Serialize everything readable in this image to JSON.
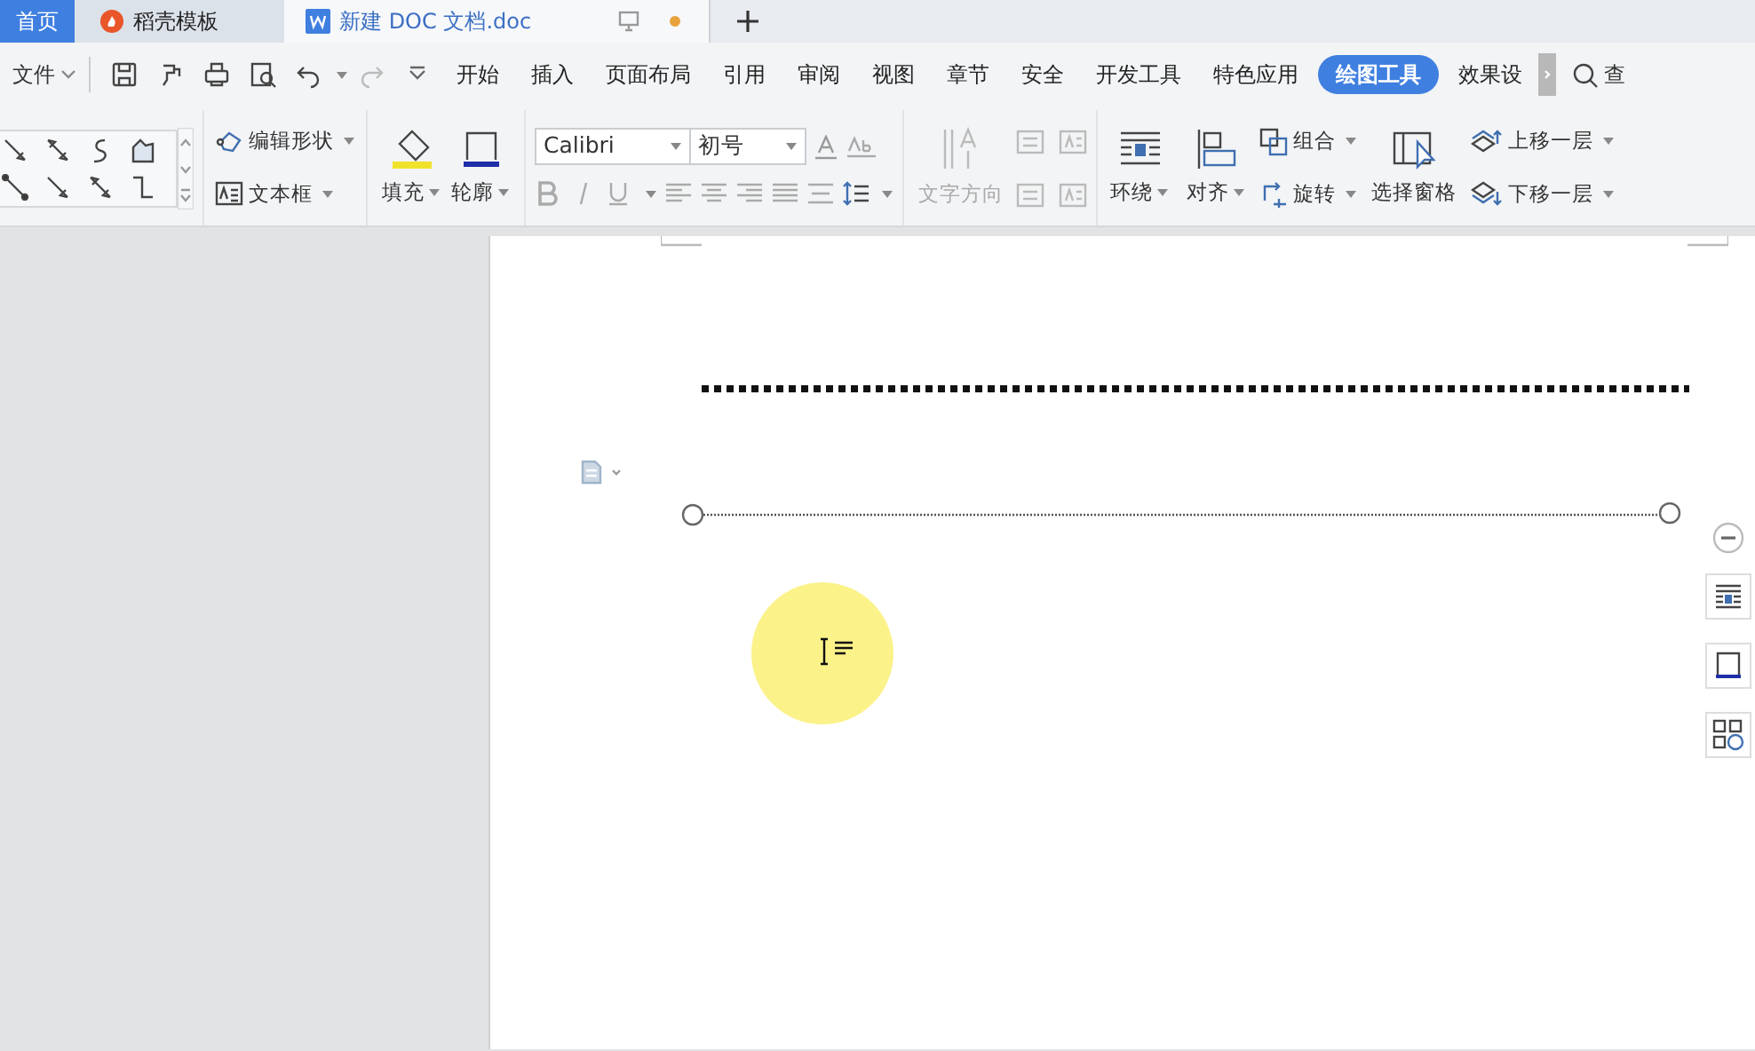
{
  "tabs": [
    {
      "kind": "home",
      "label": "首页",
      "selected": false
    },
    {
      "kind": "docer",
      "label": "稻壳模板",
      "selected": false
    },
    {
      "kind": "doc",
      "label": "新建 DOC 文档.doc",
      "selected": true,
      "unsaved": true
    }
  ],
  "menu": {
    "file": "文件",
    "ribbon_tabs": [
      {
        "label": "开始",
        "selected": false
      },
      {
        "label": "插入",
        "selected": false
      },
      {
        "label": "页面布局",
        "selected": false
      },
      {
        "label": "引用",
        "selected": false
      },
      {
        "label": "审阅",
        "selected": false
      },
      {
        "label": "视图",
        "selected": false
      },
      {
        "label": "章节",
        "selected": false
      },
      {
        "label": "安全",
        "selected": false
      },
      {
        "label": "开发工具",
        "selected": false
      },
      {
        "label": "特色应用",
        "selected": false
      },
      {
        "label": "绘图工具",
        "selected": true
      },
      {
        "label": "效果设",
        "selected": false
      }
    ],
    "search": "查"
  },
  "ribbon": {
    "shape_tools": [
      {
        "label": "编辑形状",
        "kind": "edit"
      },
      {
        "label": "文本框",
        "kind": "textbox"
      }
    ],
    "big_buttons": [
      {
        "label": "填充",
        "kind": "fill"
      },
      {
        "label": "轮廓",
        "kind": "outline"
      }
    ],
    "font": {
      "family": "Calibri",
      "size": "初号"
    },
    "text_direction": {
      "label": "文字方向",
      "disabled": true
    },
    "arrange": [
      {
        "label": "环绕",
        "kind": "wrap"
      },
      {
        "label": "对齐",
        "kind": "align"
      }
    ],
    "group_rotate": [
      {
        "label": "组合",
        "kind": "group"
      },
      {
        "label": "旋转",
        "kind": "rotate"
      }
    ],
    "selection_pane": "选择窗格",
    "layers": [
      {
        "label": "上移一层",
        "kind": "up"
      },
      {
        "label": "下移一层",
        "kind": "down"
      }
    ]
  }
}
